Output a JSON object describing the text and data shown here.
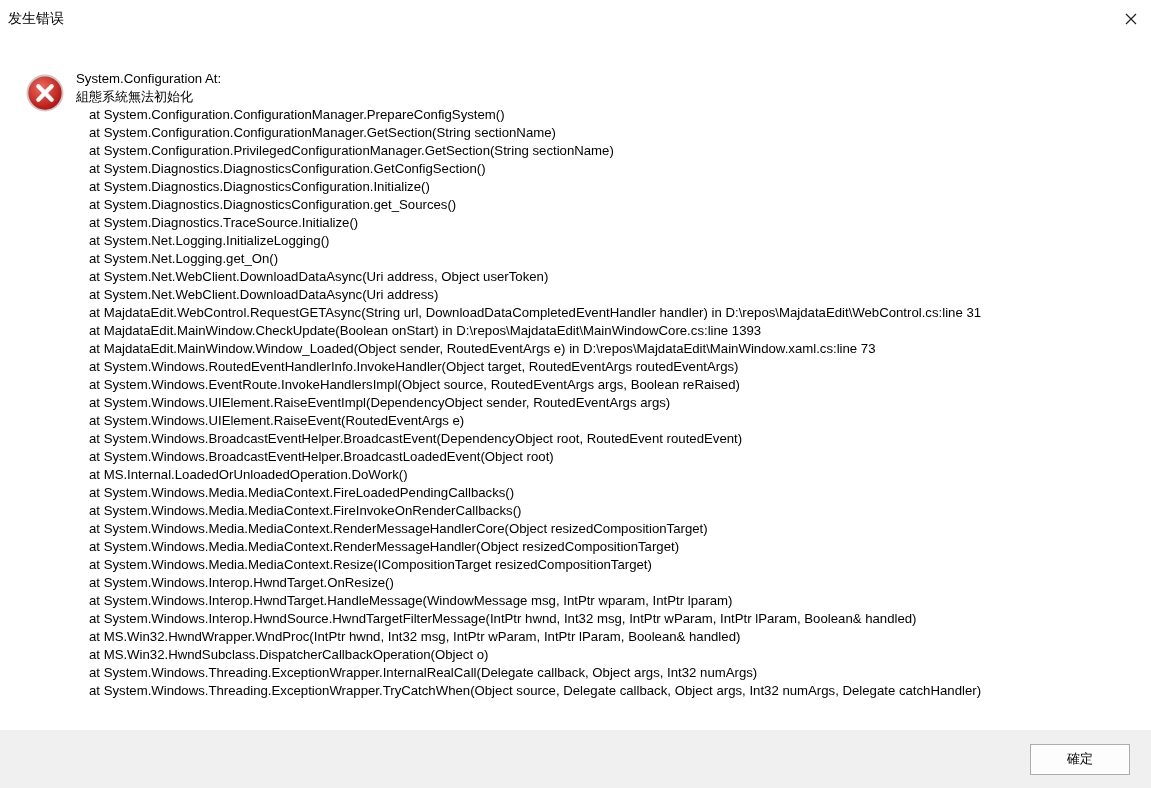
{
  "window": {
    "title": "发生错误"
  },
  "message": {
    "heading": "System.Configuration At:",
    "detail": "組態系統無法初始化",
    "stack": [
      "at System.Configuration.ConfigurationManager.PrepareConfigSystem()",
      "at System.Configuration.ConfigurationManager.GetSection(String sectionName)",
      "at System.Configuration.PrivilegedConfigurationManager.GetSection(String sectionName)",
      "at System.Diagnostics.DiagnosticsConfiguration.GetConfigSection()",
      "at System.Diagnostics.DiagnosticsConfiguration.Initialize()",
      "at System.Diagnostics.DiagnosticsConfiguration.get_Sources()",
      "at System.Diagnostics.TraceSource.Initialize()",
      "at System.Net.Logging.InitializeLogging()",
      "at System.Net.Logging.get_On()",
      "at System.Net.WebClient.DownloadDataAsync(Uri address, Object userToken)",
      "at System.Net.WebClient.DownloadDataAsync(Uri address)",
      "at MajdataEdit.WebControl.RequestGETAsync(String url, DownloadDataCompletedEventHandler handler) in D:\\repos\\MajdataEdit\\WebControl.cs:line 31",
      "at MajdataEdit.MainWindow.CheckUpdate(Boolean onStart) in D:\\repos\\MajdataEdit\\MainWindowCore.cs:line 1393",
      "at MajdataEdit.MainWindow.Window_Loaded(Object sender, RoutedEventArgs e) in D:\\repos\\MajdataEdit\\MainWindow.xaml.cs:line 73",
      "at System.Windows.RoutedEventHandlerInfo.InvokeHandler(Object target, RoutedEventArgs routedEventArgs)",
      "at System.Windows.EventRoute.InvokeHandlersImpl(Object source, RoutedEventArgs args, Boolean reRaised)",
      "at System.Windows.UIElement.RaiseEventImpl(DependencyObject sender, RoutedEventArgs args)",
      "at System.Windows.UIElement.RaiseEvent(RoutedEventArgs e)",
      "at System.Windows.BroadcastEventHelper.BroadcastEvent(DependencyObject root, RoutedEvent routedEvent)",
      "at System.Windows.BroadcastEventHelper.BroadcastLoadedEvent(Object root)",
      "at MS.Internal.LoadedOrUnloadedOperation.DoWork()",
      "at System.Windows.Media.MediaContext.FireLoadedPendingCallbacks()",
      "at System.Windows.Media.MediaContext.FireInvokeOnRenderCallbacks()",
      "at System.Windows.Media.MediaContext.RenderMessageHandlerCore(Object resizedCompositionTarget)",
      "at System.Windows.Media.MediaContext.RenderMessageHandler(Object resizedCompositionTarget)",
      "at System.Windows.Media.MediaContext.Resize(ICompositionTarget resizedCompositionTarget)",
      "at System.Windows.Interop.HwndTarget.OnResize()",
      "at System.Windows.Interop.HwndTarget.HandleMessage(WindowMessage msg, IntPtr wparam, IntPtr lparam)",
      "at System.Windows.Interop.HwndSource.HwndTargetFilterMessage(IntPtr hwnd, Int32 msg, IntPtr wParam, IntPtr lParam, Boolean& handled)",
      "at MS.Win32.HwndWrapper.WndProc(IntPtr hwnd, Int32 msg, IntPtr wParam, IntPtr lParam, Boolean& handled)",
      "at MS.Win32.HwndSubclass.DispatcherCallbackOperation(Object o)",
      "at System.Windows.Threading.ExceptionWrapper.InternalRealCall(Delegate callback, Object args, Int32 numArgs)",
      "at System.Windows.Threading.ExceptionWrapper.TryCatchWhen(Object source, Delegate callback, Object args, Int32 numArgs, Delegate catchHandler)"
    ]
  },
  "buttons": [
    "確定"
  ]
}
